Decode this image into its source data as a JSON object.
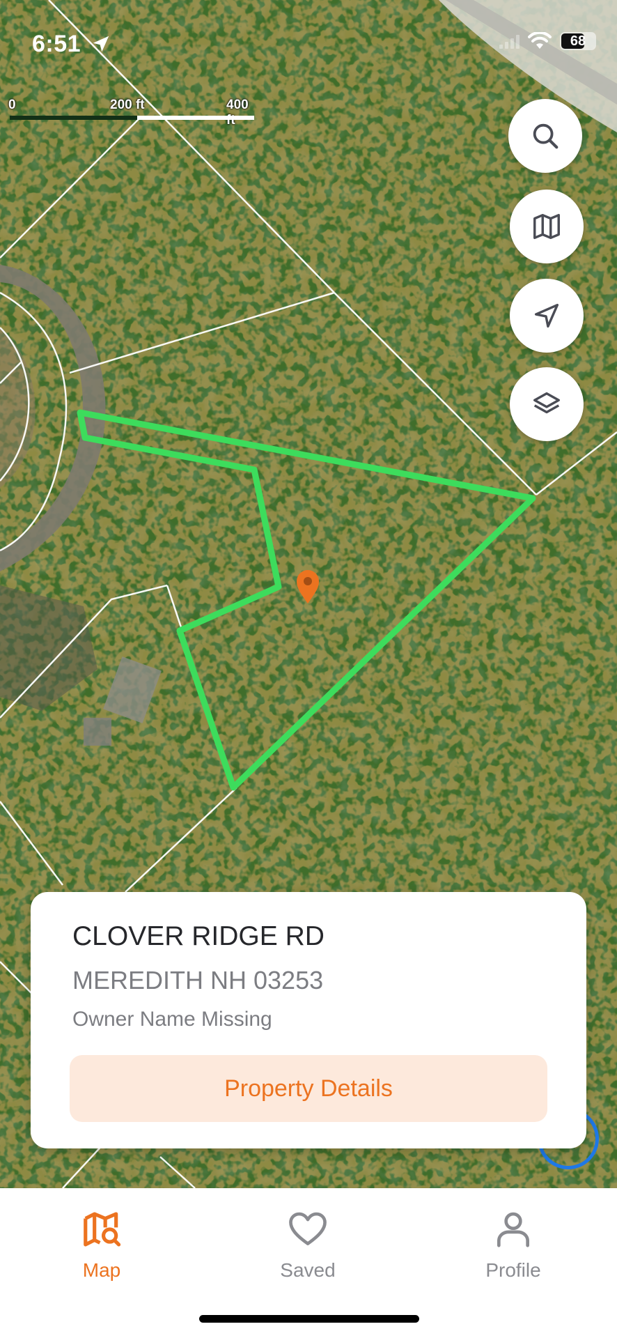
{
  "status_bar": {
    "time": "6:51",
    "battery": "68",
    "battery_level": 0.68,
    "icons": [
      "location-arrow-icon",
      "signal-icon",
      "wifi-icon",
      "battery-icon"
    ]
  },
  "scale_bar": {
    "labels": [
      "0",
      "200 ft",
      "400 ft"
    ]
  },
  "map": {
    "buttons": [
      {
        "name": "search",
        "icon": "search-icon"
      },
      {
        "name": "map-style",
        "icon": "map-icon"
      },
      {
        "name": "locate",
        "icon": "navigation-arrow-icon"
      },
      {
        "name": "layers",
        "icon": "layers-icon"
      }
    ],
    "parcel_outline_color": "#3ddc5c",
    "marker_color": "#ec7320",
    "parcel_line_color": "#ffffff"
  },
  "property_card": {
    "street": "CLOVER RIDGE RD",
    "city_line": "MEREDITH NH 03253",
    "owner": "Owner Name Missing",
    "button_label": "Property Details"
  },
  "tab_bar": {
    "active": "Map",
    "tabs": [
      {
        "label": "Map",
        "icon": "map-search-icon"
      },
      {
        "label": "Saved",
        "icon": "heart-icon"
      },
      {
        "label": "Profile",
        "icon": "person-icon"
      }
    ]
  },
  "colors": {
    "accent": "#ec7320",
    "accent_light": "#fde9dc",
    "info_blue": "#1e78e6"
  }
}
